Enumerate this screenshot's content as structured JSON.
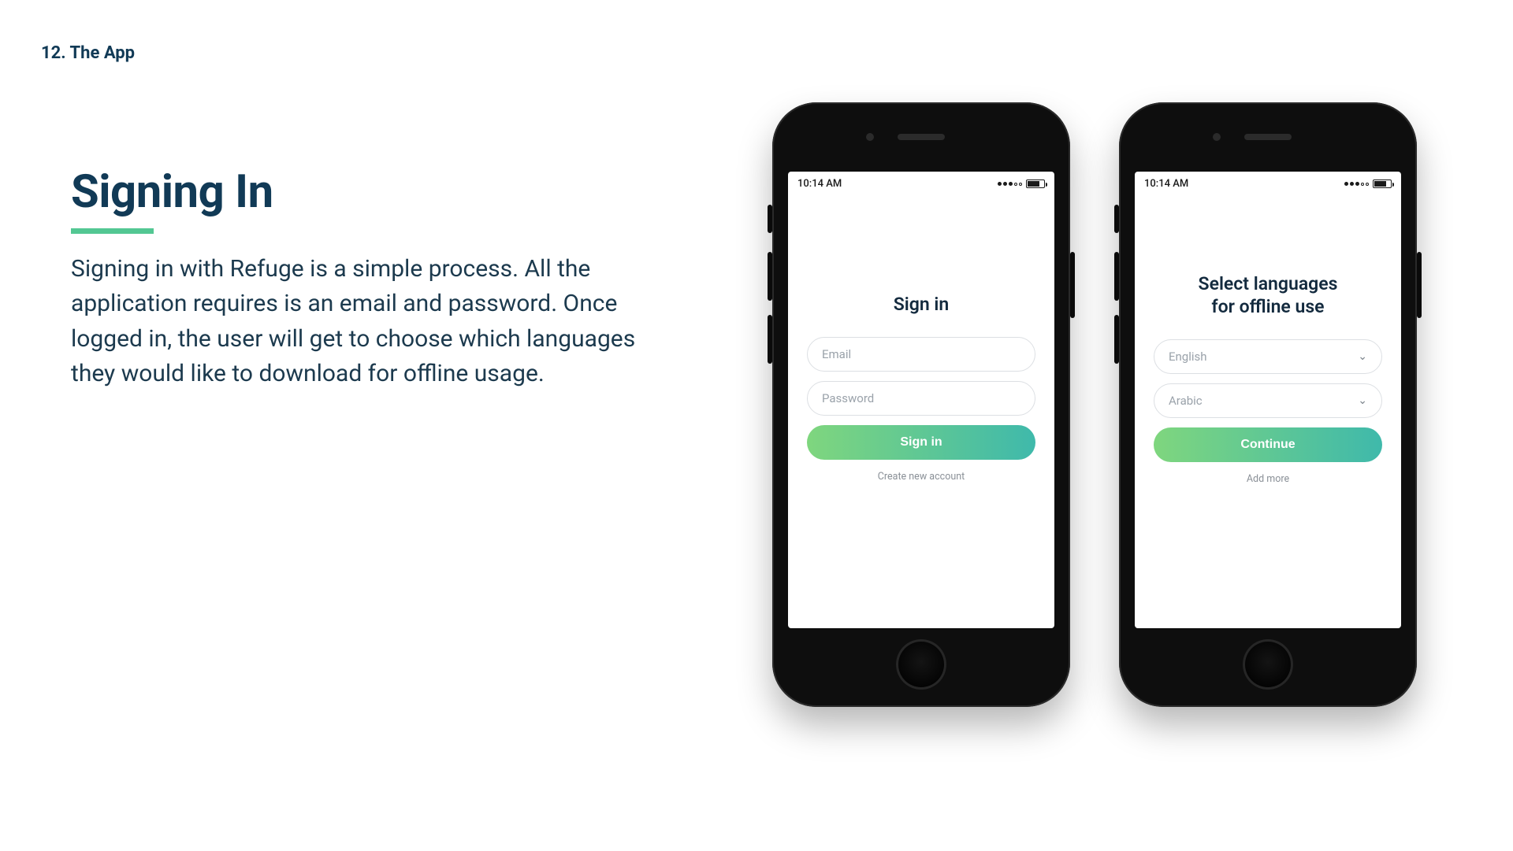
{
  "section_label": "12. The App",
  "heading": "Signing In",
  "body": "Signing in with Refuge is a simple process. All the application requires is an email and password. Once logged in, the user will get to choose which languages they would like to download for offline usage.",
  "statusbar": {
    "time": "10:14 AM"
  },
  "phone1": {
    "title": "Sign in",
    "email_placeholder": "Email",
    "password_placeholder": "Password",
    "cta": "Sign in",
    "sublink": "Create new account"
  },
  "phone2": {
    "title_line1": "Select languages",
    "title_line2": "for offline use",
    "lang1": "English",
    "lang2": "Arabic",
    "cta": "Continue",
    "sublink": "Add more"
  }
}
